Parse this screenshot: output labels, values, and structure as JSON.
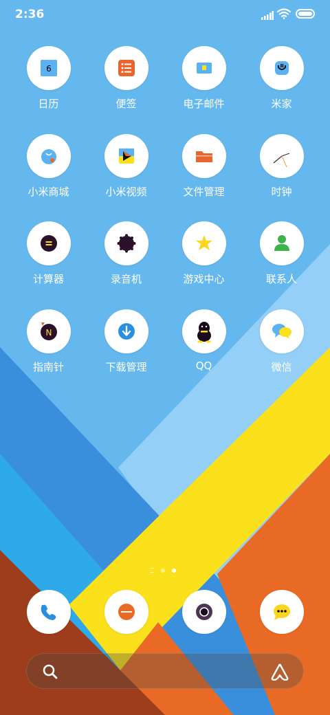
{
  "status_bar": {
    "time": "2:36",
    "icons": [
      "signal-icon",
      "wifi-icon",
      "battery-icon"
    ]
  },
  "apps": [
    {
      "label": "日历",
      "icon": "calendar-icon",
      "badge": "6"
    },
    {
      "label": "便签",
      "icon": "notes-icon"
    },
    {
      "label": "电子邮件",
      "icon": "email-icon"
    },
    {
      "label": "米家",
      "icon": "mijia-icon"
    },
    {
      "label": "小米商城",
      "icon": "mi-store-icon"
    },
    {
      "label": "小米视频",
      "icon": "mi-video-icon"
    },
    {
      "label": "文件管理",
      "icon": "file-manager-icon"
    },
    {
      "label": "时钟",
      "icon": "clock-icon"
    },
    {
      "label": "计算器",
      "icon": "calculator-icon"
    },
    {
      "label": "录音机",
      "icon": "recorder-icon"
    },
    {
      "label": "游戏中心",
      "icon": "game-center-icon"
    },
    {
      "label": "联系人",
      "icon": "contacts-icon"
    },
    {
      "label": "指南针",
      "icon": "compass-icon",
      "badge": "N"
    },
    {
      "label": "下载管理",
      "icon": "downloads-icon"
    },
    {
      "label": "QQ",
      "icon": "qq-icon"
    },
    {
      "label": "微信",
      "icon": "wechat-icon"
    }
  ],
  "page_indicator": {
    "pages": 3,
    "active": 2
  },
  "dock": [
    {
      "icon": "phone-icon"
    },
    {
      "icon": "browser-icon"
    },
    {
      "icon": "camera-icon"
    },
    {
      "icon": "messages-icon"
    }
  ],
  "search": {
    "icons": [
      "search-icon",
      "assistant-icon"
    ]
  },
  "colors": {
    "sky": "#65b8ee",
    "light_blue": "#93cff6",
    "mid_blue": "#3a8fdd",
    "cyan": "#2ea9ea",
    "yellow": "#fbe01c",
    "orange": "#e96a25",
    "brown": "#9e3d1b"
  }
}
